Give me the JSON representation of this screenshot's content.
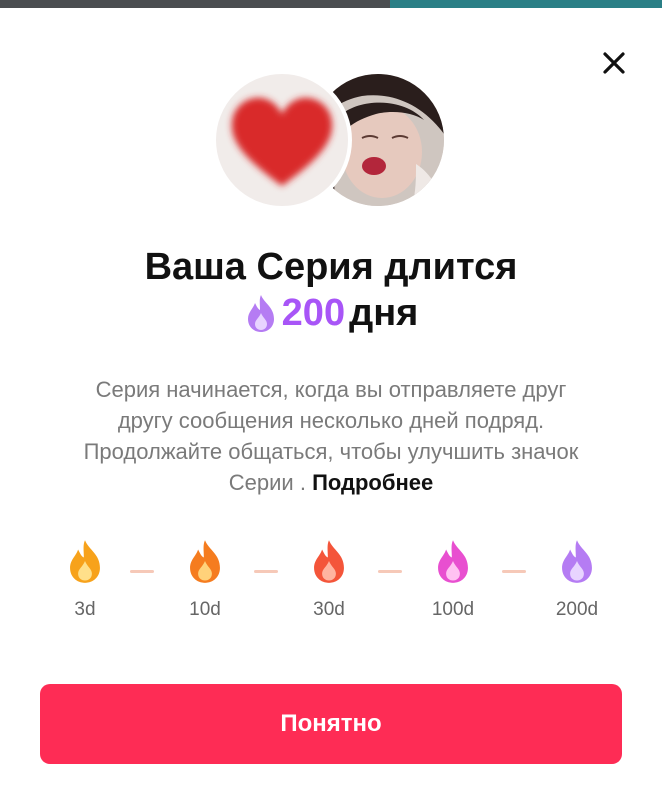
{
  "dialog": {
    "title_line1": "Ваша Серия длится",
    "streak_count": "200",
    "streak_unit": "дня",
    "description": "Серия начинается, когда вы отправляете друг другу сообщения несколько дней подряд. Продолжайте общаться, чтобы улучшить значок Серии . ",
    "more_link": "Подробнее",
    "confirm_button": "Понятно"
  },
  "milestones": [
    {
      "label": "3d",
      "color": "#f7a21b"
    },
    {
      "label": "10d",
      "color": "#f57c1f"
    },
    {
      "label": "30d",
      "color": "#f4553a"
    },
    {
      "label": "100d",
      "color": "#e84fd0"
    },
    {
      "label": "200d",
      "color": "#b57cf3"
    }
  ],
  "colors": {
    "accent": "#fe2c55",
    "streak": "#a855f7"
  }
}
